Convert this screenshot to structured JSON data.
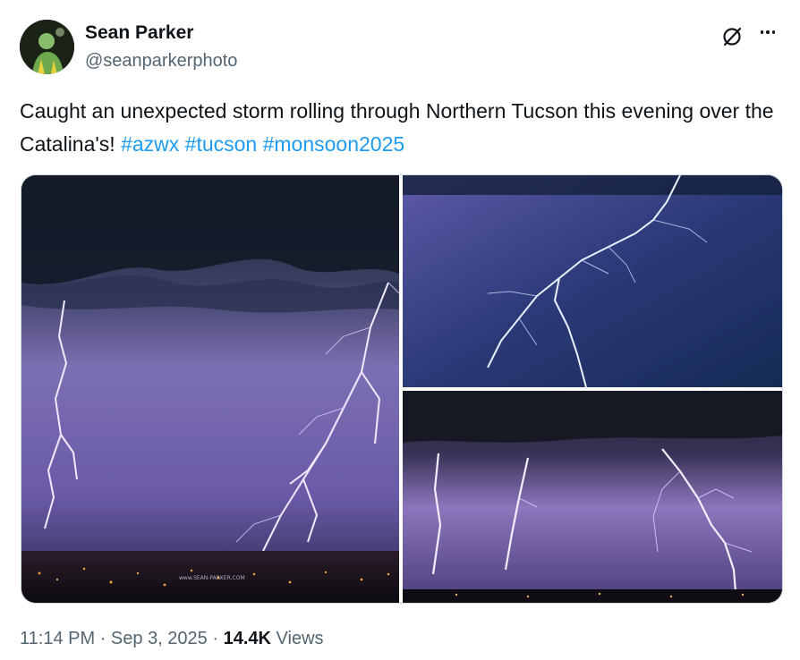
{
  "author": {
    "display_name": "Sean Parker",
    "handle": "@seanparkerphoto"
  },
  "tweet": {
    "text_plain": "Caught an unexpected storm rolling through Northern Tucson this evening over the Catalina's! ",
    "hashtags": [
      "#azwx",
      "#tucson",
      "#monsoon2025"
    ]
  },
  "photo_watermark": "www.SEAN-PARKER.COM",
  "footer": {
    "time": "11:14 PM",
    "separator": "·",
    "date": "Sep 3, 2025",
    "views_count": "14.4K",
    "views_label": "Views"
  },
  "icons": {
    "grok": "grok-icon",
    "more": "more-icon"
  },
  "colors": {
    "text": "#0f1419",
    "secondary": "#536471",
    "link": "#1d9bf0"
  }
}
